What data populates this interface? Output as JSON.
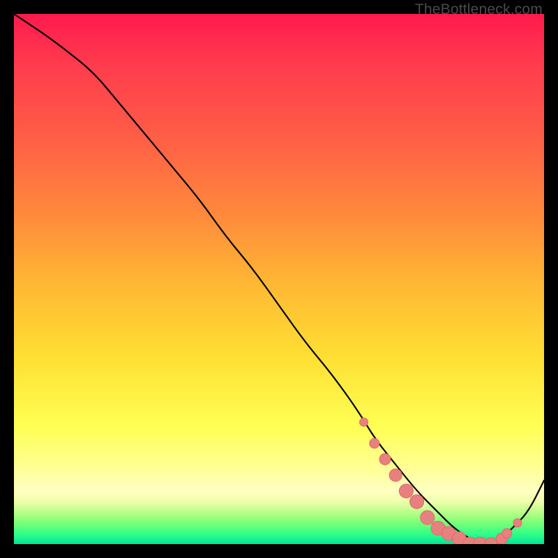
{
  "watermark": "TheBottleneck.com",
  "colors": {
    "curve": "#000000",
    "marker_fill": "#e88080",
    "marker_stroke": "#e06666",
    "background_black": "#000000"
  },
  "chart_data": {
    "type": "line",
    "title": "",
    "xlabel": "",
    "ylabel": "",
    "xlim": [
      0,
      100
    ],
    "ylim": [
      0,
      100
    ],
    "series": [
      {
        "name": "bottleneck-curve",
        "x": [
          0,
          3,
          6,
          10,
          15,
          20,
          25,
          30,
          35,
          40,
          45,
          50,
          55,
          60,
          65,
          68,
          72,
          76,
          80,
          83,
          86,
          88,
          90,
          92,
          94,
          97,
          100
        ],
        "values": [
          100,
          98,
          96,
          93,
          89,
          83,
          77,
          71,
          65,
          58,
          52,
          45,
          38,
          32,
          25,
          20,
          15,
          10,
          6,
          3,
          1,
          0,
          0,
          1,
          3,
          6,
          12
        ]
      }
    ],
    "markers": {
      "name": "optimal-zone",
      "x": [
        66,
        68,
        70,
        72,
        74,
        76,
        78,
        80,
        82,
        84,
        86,
        88,
        90,
        92,
        93,
        95
      ],
      "values": [
        23,
        19,
        16,
        13,
        10,
        8,
        5,
        3,
        2,
        1,
        0,
        0,
        0,
        1,
        2,
        4
      ],
      "sizes": [
        6,
        7,
        8,
        9,
        10,
        10,
        10,
        10,
        10,
        10,
        10,
        10,
        9,
        8,
        7,
        6
      ]
    }
  }
}
